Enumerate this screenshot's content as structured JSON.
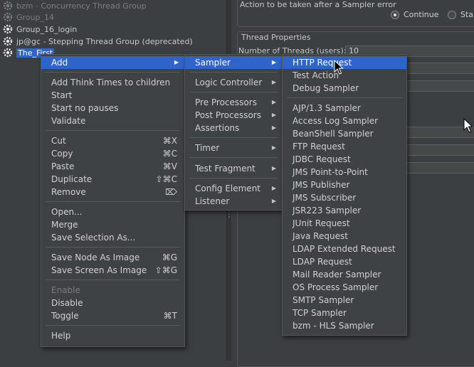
{
  "tree": {
    "items": [
      {
        "label": "bzm - Concurrency Thread Group",
        "state": "dim"
      },
      {
        "label": "Group_14",
        "state": "dim"
      },
      {
        "label": "Group_16_login",
        "state": "normal"
      },
      {
        "label": "jp@gc - Stepping Thread Group (deprecated)",
        "state": "normal"
      },
      {
        "label": "The_First",
        "state": "selected"
      }
    ]
  },
  "right_panel": {
    "error_title": "Action to be taken after a Sampler error",
    "continue_label": "Continue",
    "start_next_label": "Sta",
    "thread_props_title": "Thread Properties",
    "threads_label": "Number of Threads (users):",
    "threads_value": "10"
  },
  "context_menu": {
    "add": "Add",
    "add_think_times": "Add Think Times to children",
    "start": "Start",
    "start_no_pauses": "Start no pauses",
    "validate": "Validate",
    "cut": "Cut",
    "cut_sc": "⌘X",
    "copy": "Copy",
    "copy_sc": "⌘C",
    "paste": "Paste",
    "paste_sc": "⌘V",
    "duplicate": "Duplicate",
    "duplicate_sc": "⇧⌘C",
    "remove": "Remove",
    "remove_sc": "⌦",
    "open": "Open...",
    "merge": "Merge",
    "save_selection": "Save Selection As...",
    "save_node_image": "Save Node As Image",
    "save_node_image_sc": "⌘G",
    "save_screen_image": "Save Screen As Image",
    "save_screen_image_sc": "⇧⌘G",
    "enable": "Enable",
    "disable": "Disable",
    "toggle": "Toggle",
    "toggle_sc": "⌘T",
    "help": "Help"
  },
  "add_menu": {
    "sampler": "Sampler",
    "logic_controller": "Logic Controller",
    "pre_processors": "Pre Processors",
    "post_processors": "Post Processors",
    "assertions": "Assertions",
    "timer": "Timer",
    "test_fragment": "Test Fragment",
    "config_element": "Config Element",
    "listener": "Listener"
  },
  "sampler_menu": {
    "http_request": "HTTP Request",
    "test_action": "Test Action",
    "debug_sampler": "Debug Sampler",
    "ajp": "AJP/1.3 Sampler",
    "access_log": "Access Log Sampler",
    "beanshell": "BeanShell Sampler",
    "ftp": "FTP Request",
    "jdbc": "JDBC Request",
    "jms_p2p": "JMS Point-to-Point",
    "jms_pub": "JMS Publisher",
    "jms_sub": "JMS Subscriber",
    "jsr223": "JSR223 Sampler",
    "junit": "JUnit Request",
    "java": "Java Request",
    "ldap_ext": "LDAP Extended Request",
    "ldap": "LDAP Request",
    "mail_reader": "Mail Reader Sampler",
    "os_process": "OS Process Sampler",
    "smtp": "SMTP Sampler",
    "tcp": "TCP Sampler",
    "hls": "bzm - HLS Sampler"
  },
  "colors": {
    "highlight": "#2f65ca",
    "menu_bg": "#3e4244",
    "panel_bg": "#3c3f41"
  }
}
